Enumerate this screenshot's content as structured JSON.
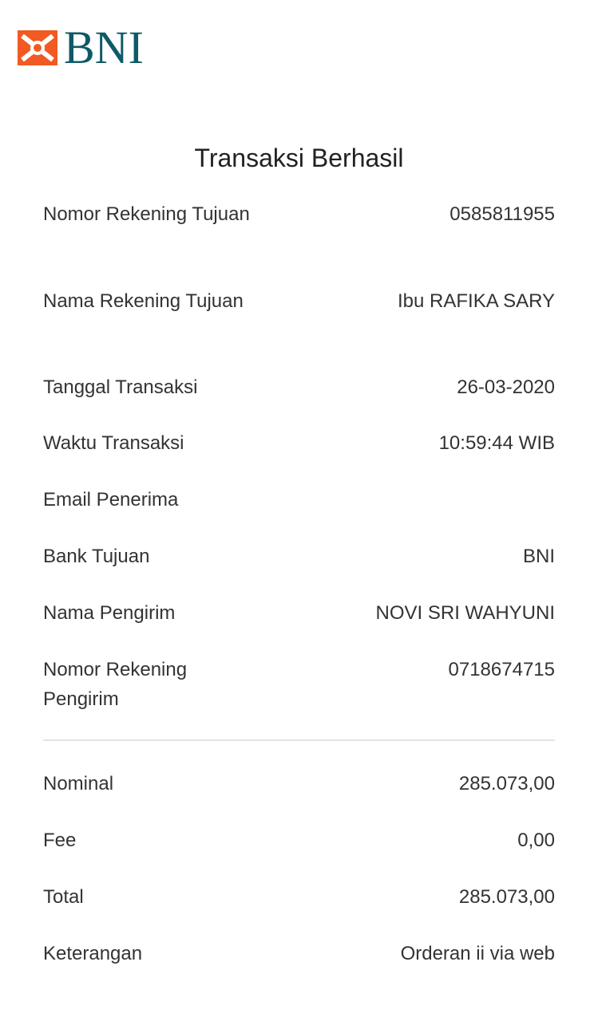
{
  "header": {
    "brand_name": "BNI",
    "brand_color": "#0e5a66",
    "accent_color": "#f15a22"
  },
  "page": {
    "title": "Transaksi Berhasil"
  },
  "details": [
    {
      "label": "Nomor Rekening Tujuan",
      "value": "0585811955"
    },
    {
      "label": "Nama Rekening Tujuan",
      "value": "Ibu RAFIKA SARY"
    },
    {
      "label": "Tanggal Transaksi",
      "value": "26-03-2020"
    },
    {
      "label": "Waktu Transaksi",
      "value": "10:59:44 WIB"
    },
    {
      "label": "Email Penerima",
      "value": ""
    },
    {
      "label": "Bank Tujuan",
      "value": "BNI"
    },
    {
      "label": "Nama Pengirim",
      "value": "NOVI SRI WAHYUNI"
    },
    {
      "label": "Nomor Rekening Pengirim",
      "value": "0718674715"
    }
  ],
  "amounts": [
    {
      "label": "Nominal",
      "value": "285.073,00"
    },
    {
      "label": "Fee",
      "value": "0,00"
    },
    {
      "label": "Total",
      "value": "285.073,00"
    },
    {
      "label": "Keterangan",
      "value": "Orderan ii via web"
    }
  ]
}
